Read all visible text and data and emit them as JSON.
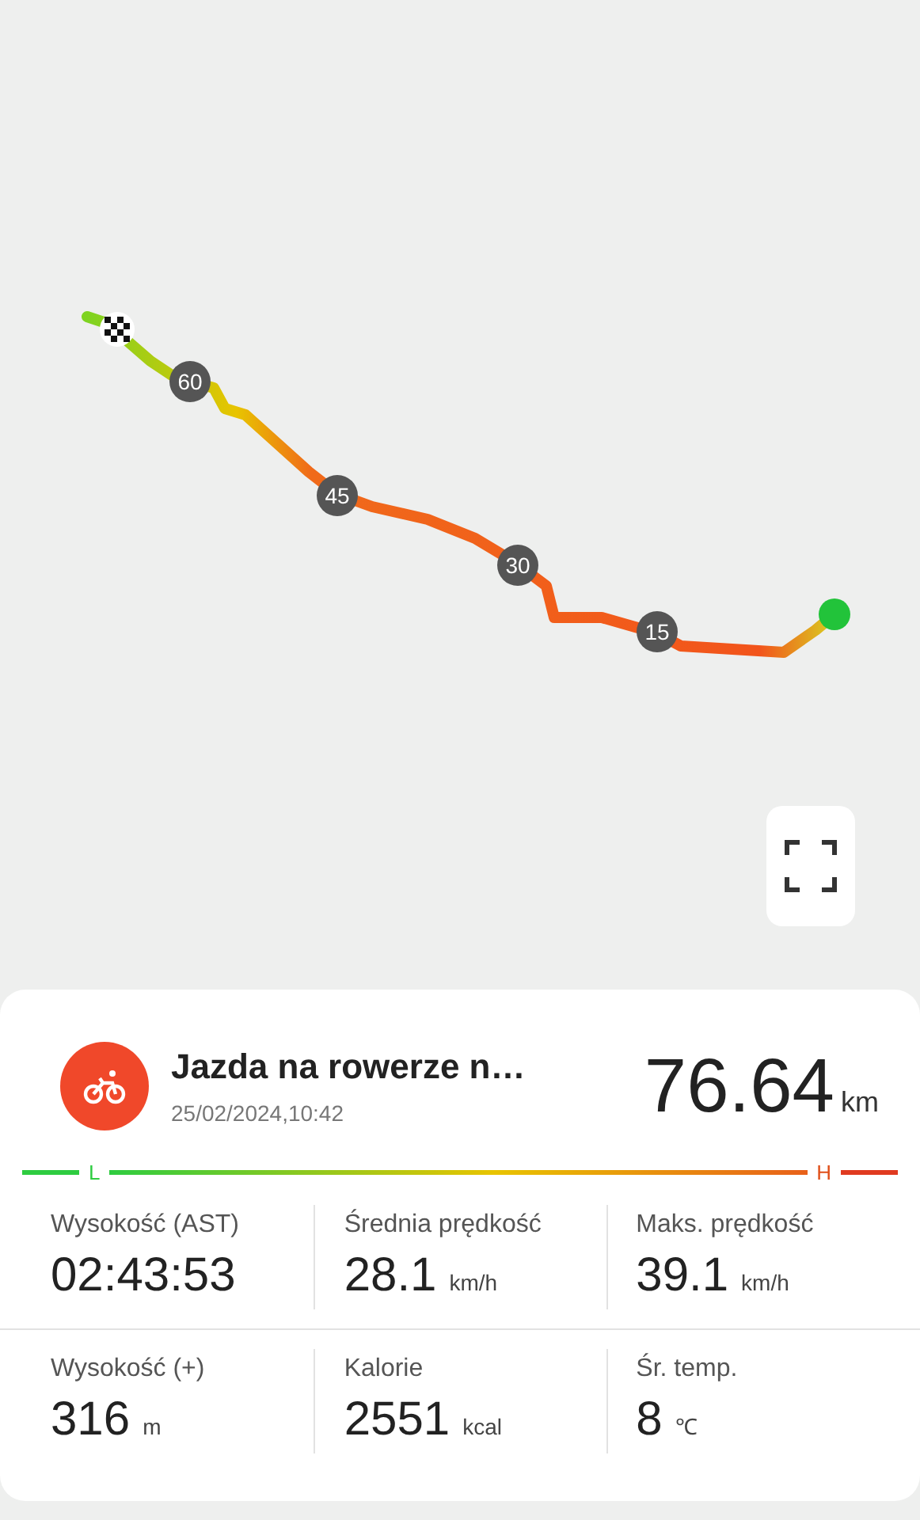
{
  "map": {
    "km_markers": [
      {
        "label": "60"
      },
      {
        "label": "45"
      },
      {
        "label": "30"
      },
      {
        "label": "15"
      }
    ]
  },
  "activity": {
    "title": "Jazda na rowerze n…",
    "datetime": "25/02/2024,10:42",
    "distance": "76.64",
    "distance_unit": "km"
  },
  "legend": {
    "low": "L",
    "high": "H"
  },
  "stats": [
    {
      "label": "Wysokość (AST)",
      "value": "02:43:53"
    },
    {
      "label": "Średnia prędkość",
      "value": "28.1",
      "unit": "km/h"
    },
    {
      "label": "Maks. prędkość",
      "value": "39.1",
      "unit": "km/h"
    },
    {
      "label": "Wysokość (+)",
      "value": "316",
      "unit": "m"
    },
    {
      "label": "Kalorie",
      "value": "2551",
      "unit": "kcal"
    },
    {
      "label": "Śr. temp.",
      "value": "8",
      "unit": "℃"
    }
  ]
}
